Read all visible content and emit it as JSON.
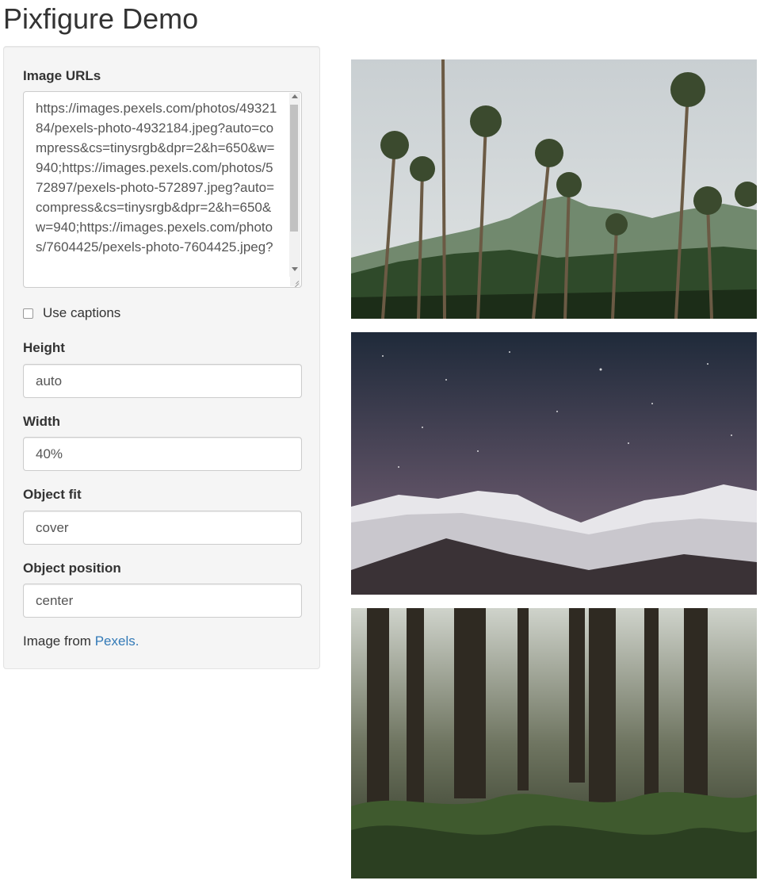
{
  "page": {
    "title": "Pixfigure Demo"
  },
  "form": {
    "image_urls": {
      "label": "Image URLs",
      "value": "https://images.pexels.com/photos/4932184/pexels-photo-4932184.jpeg?auto=compress&cs=tinysrgb&dpr=2&h=650&w=940;https://images.pexels.com/photos/572897/pexels-photo-572897.jpeg?auto=compress&cs=tinysrgb&dpr=2&h=650&w=940;https://images.pexels.com/photos/7604425/pexels-photo-7604425.jpeg?"
    },
    "use_captions": {
      "label": "Use captions",
      "checked": false
    },
    "height": {
      "label": "Height",
      "value": "auto"
    },
    "width": {
      "label": "Width",
      "value": "40%"
    },
    "object_fit": {
      "label": "Object fit",
      "value": "cover"
    },
    "object_position": {
      "label": "Object position",
      "value": "center"
    }
  },
  "footer": {
    "prefix": "Image from ",
    "link_text": "Pexels."
  },
  "images": [
    {
      "subject": "palm trees and misty mountains"
    },
    {
      "subject": "snowy mountains under starry sky"
    },
    {
      "subject": "redwood forest with ferns"
    }
  ],
  "colors": {
    "link": "#337ab7",
    "panel_bg": "#f5f5f5",
    "text": "#333333"
  }
}
